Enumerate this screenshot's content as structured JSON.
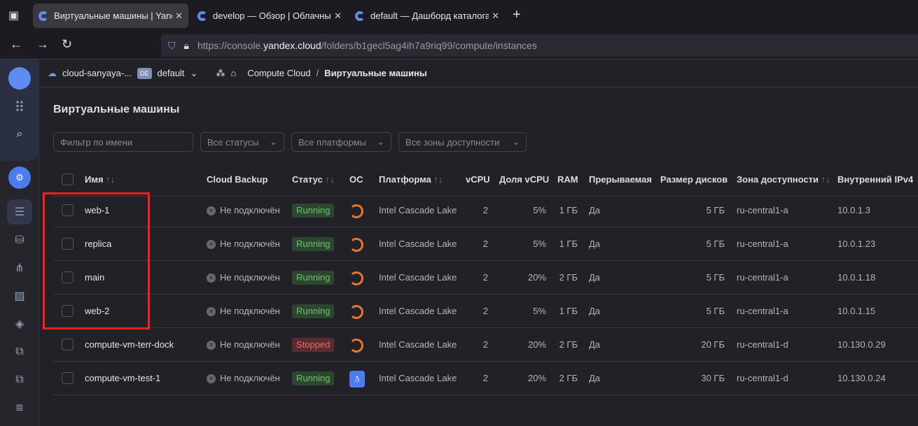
{
  "browser": {
    "tabs": [
      {
        "label": "Виртуальные машины | Yandex Cloud"
      },
      {
        "label": "develop — Обзор | Облачные сети"
      },
      {
        "label": "default — Дашборд каталога | Yandex Cloud"
      }
    ],
    "url_prefix": "https://console.",
    "url_host": "yandex.cloud",
    "url_path": "/folders/b1gecl5ag4ih7a9riq99/compute/instances"
  },
  "breadcrumb": {
    "cloud": "cloud-sanyaya-...",
    "folder_badge": "DE",
    "folder": "default",
    "service": "Compute Cloud",
    "sep": "/",
    "page": "Виртуальные машины"
  },
  "page_title": "Виртуальные машины",
  "filters": {
    "name_placeholder": "Фильтр по имени",
    "status": "Все статусы",
    "platform": "Все платформы",
    "zone": "Все зоны доступности"
  },
  "table": {
    "headers": [
      "Имя",
      "Cloud Backup",
      "Статус",
      "ОС",
      "Платформа",
      "vCPU",
      "Доля vCPU",
      "RAM",
      "Прерываемая",
      "Размер дисков",
      "Зона доступности",
      "Внутренний IPv4"
    ],
    "sort_icon": "↑↓",
    "rows": [
      {
        "name": "web-1",
        "backup": "Не подключён",
        "status": "Running",
        "os": "ubuntu",
        "platform": "Intel Cascade Lake",
        "vcpu": "2",
        "share": "5%",
        "ram": "1 ГБ",
        "preempt": "Да",
        "disk": "5 ГБ",
        "zone": "ru-central1-a",
        "ip": "10.0.1.3"
      },
      {
        "name": "replica",
        "backup": "Не подключён",
        "status": "Running",
        "os": "ubuntu",
        "platform": "Intel Cascade Lake",
        "vcpu": "2",
        "share": "5%",
        "ram": "1 ГБ",
        "preempt": "Да",
        "disk": "5 ГБ",
        "zone": "ru-central1-a",
        "ip": "10.0.1.23"
      },
      {
        "name": "main",
        "backup": "Не подключён",
        "status": "Running",
        "os": "ubuntu",
        "platform": "Intel Cascade Lake",
        "vcpu": "2",
        "share": "20%",
        "ram": "2 ГБ",
        "preempt": "Да",
        "disk": "5 ГБ",
        "zone": "ru-central1-a",
        "ip": "10.0.1.18"
      },
      {
        "name": "web-2",
        "backup": "Не подключён",
        "status": "Running",
        "os": "ubuntu",
        "platform": "Intel Cascade Lake",
        "vcpu": "2",
        "share": "5%",
        "ram": "1 ГБ",
        "preempt": "Да",
        "disk": "5 ГБ",
        "zone": "ru-central1-a",
        "ip": "10.0.1.15"
      },
      {
        "name": "compute-vm-terr-dock",
        "backup": "Не подключён",
        "status": "Stopped",
        "os": "ubuntu",
        "platform": "Intel Cascade Lake",
        "vcpu": "2",
        "share": "20%",
        "ram": "2 ГБ",
        "preempt": "Да",
        "disk": "20 ГБ",
        "zone": "ru-central1-d",
        "ip": "10.130.0.29"
      },
      {
        "name": "compute-vm-test-1",
        "backup": "Не подключён",
        "status": "Running",
        "os": "linux-tux",
        "platform": "Intel Cascade Lake",
        "vcpu": "2",
        "share": "20%",
        "ram": "2 ГБ",
        "preempt": "Да",
        "disk": "30 ГБ",
        "zone": "ru-central1-d",
        "ip": "10.130.0.24"
      }
    ]
  },
  "colors": {
    "running": "#6cc26e",
    "stopped": "#e86b6b",
    "accent": "#4f7bf0",
    "highlight": "#ff1e1e"
  }
}
